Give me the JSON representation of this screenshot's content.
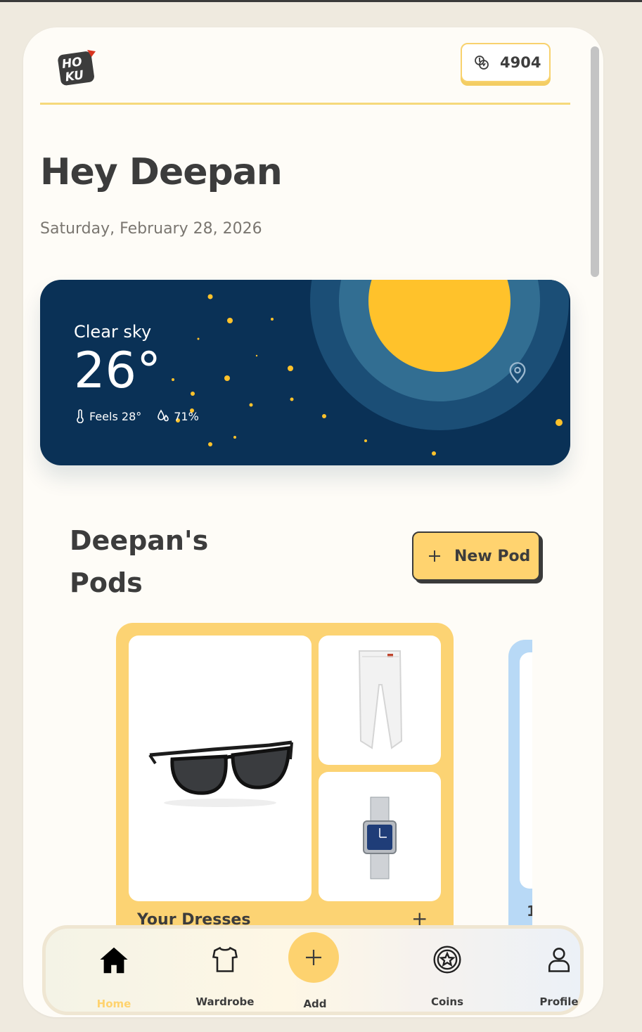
{
  "header": {
    "brand": "HOKU",
    "coins": "4904"
  },
  "greeting": "Hey Deepan",
  "date": "Saturday, February 28, 2026",
  "weather": {
    "condition": "Clear sky",
    "temperature": "26°",
    "feels_like": "Feels 28°",
    "humidity": "71%",
    "colors": {
      "bg": "#0a3156",
      "sun": "#ffc22b",
      "ring1": "#1b4e76",
      "ring2": "#326e92"
    }
  },
  "pods": {
    "title": "Deepan's Pods",
    "new_pod_label": "New Pod",
    "cards": [
      {
        "name": "Your Dresses",
        "items": [
          "sunglasses",
          "white-jeans",
          "wristwatch"
        ],
        "color": "#fcd373"
      },
      {
        "name": "1",
        "color": "#b8d9f6"
      }
    ]
  },
  "nav": {
    "items": [
      {
        "label": "Home",
        "icon": "home-icon",
        "active": true
      },
      {
        "label": "Wardrobe",
        "icon": "shirt-icon",
        "active": false
      },
      {
        "label": "Add",
        "icon": "plus-icon",
        "active": false
      },
      {
        "label": "Coins",
        "icon": "coin-star-icon",
        "active": false
      },
      {
        "label": "Profile",
        "icon": "user-icon",
        "active": false
      }
    ]
  },
  "colors": {
    "accent": "#ffd36f",
    "text": "#3c3c3c",
    "background": "#fefcf7"
  }
}
